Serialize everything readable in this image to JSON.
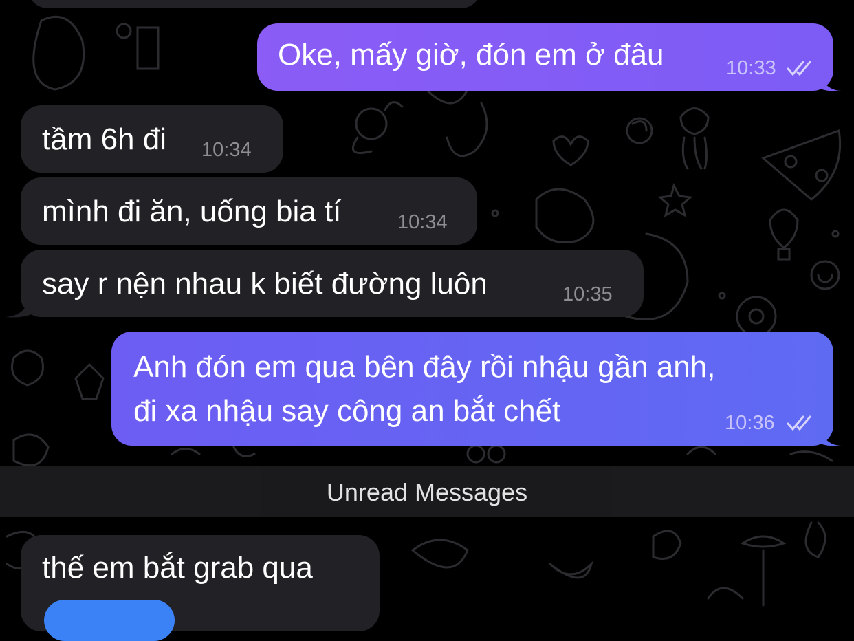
{
  "messages": [
    {
      "direction": "outgoing",
      "text_lines": [
        "Oke, mấy giờ, đón em ở đâu"
      ],
      "time": "10:33",
      "read": true
    },
    {
      "direction": "incoming",
      "text_lines": [
        "tầm 6h đi"
      ],
      "time": "10:34"
    },
    {
      "direction": "incoming",
      "text_lines": [
        "mình đi ăn, uống bia tí"
      ],
      "time": "10:34"
    },
    {
      "direction": "incoming",
      "text_lines": [
        "say r nện nhau k biết đường luôn"
      ],
      "time": "10:35"
    },
    {
      "direction": "outgoing",
      "text_lines": [
        "Anh đón em qua bên đây rồi nhậu gần anh,",
        "đi xa nhậu say công an bắt chết"
      ],
      "time": "10:36",
      "read": true
    },
    {
      "direction": "incoming",
      "text_lines": [
        "thế em bắt grab qua"
      ],
      "time": ""
    }
  ],
  "unread_divider": {
    "label": "Unread Messages"
  },
  "colors": {
    "background": "#000000",
    "incoming_bubble": "#212126",
    "outgoing_bubble_top": "#8b5cf6",
    "outgoing_bubble_bottom": "#5f6af3",
    "divider": "#1c1c1e"
  }
}
